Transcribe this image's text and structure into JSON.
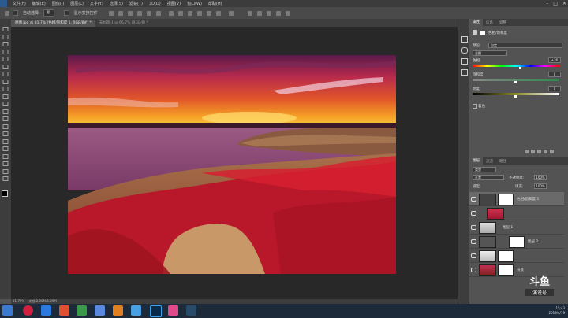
{
  "menu": {
    "items": [
      "文件(F)",
      "编辑(E)",
      "图像(I)",
      "图层(L)",
      "文字(Y)",
      "选择(S)",
      "滤镜(T)",
      "3D(D)",
      "视图(V)",
      "窗口(W)",
      "帮助(H)"
    ]
  },
  "options_bar": {
    "auto_select_label": "自动选择:",
    "auto_select_value": "组",
    "show_transform_label": "显示变换控件"
  },
  "document_tabs": [
    {
      "label": "原图.jpg @ 81.7% (色相/饱和度 1, RGB/8#) *",
      "active": true
    },
    {
      "label": "未标题-1 @ 66.7% (RGB/8) *",
      "active": false
    }
  ],
  "properties_panel": {
    "tabs": [
      "属性",
      "信息",
      "调整"
    ],
    "title": "色相/饱和度",
    "preset_label": "预设:",
    "preset_value": "自定",
    "channel_value": "全图",
    "hue_label": "色相:",
    "hue_value": "+26",
    "saturation_label": "饱和度:",
    "saturation_value": "0",
    "lightness_label": "明度:",
    "lightness_value": "0",
    "colorize_label": "着色"
  },
  "layers_panel": {
    "tabs": [
      "图层",
      "通道",
      "路径"
    ],
    "kind_label": "类型",
    "blend_mode": "正常",
    "opacity_label": "不透明度:",
    "opacity_value": "100%",
    "lock_label": "锁定:",
    "fill_label": "填充:",
    "fill_value": "100%",
    "layers": [
      {
        "name": "色相/饱和度 1",
        "selected": true
      },
      {
        "name": "",
        "selected": false
      },
      {
        "name": "图层 1",
        "selected": false
      },
      {
        "name": "图层 2",
        "selected": false
      },
      {
        "name": "背景",
        "selected": false
      }
    ]
  },
  "status_bar": {
    "zoom": "81.75%",
    "doc_info": "文档:2.08M/5.89M"
  },
  "watermark": {
    "line1": "斗鱼",
    "line2": "演说号"
  },
  "clock": {
    "time": "15:43",
    "date": "2019/4/19"
  },
  "colors": {
    "ui_dark": "#3c3c3c",
    "ui_mid": "#535353",
    "canvas": "#282828",
    "accent_red": "#c0182a"
  }
}
